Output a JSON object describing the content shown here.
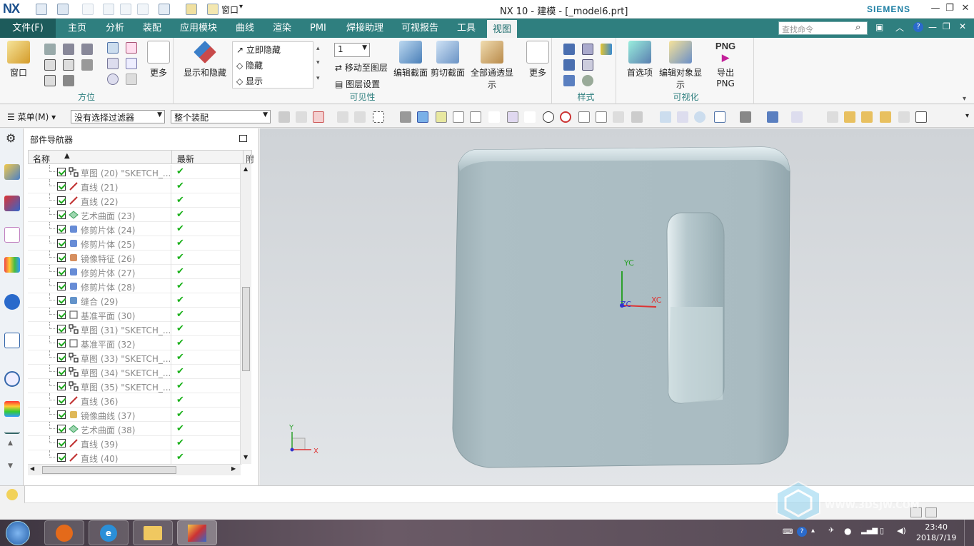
{
  "titlebar": {
    "logo": "NX",
    "window_title": "NX 10 - 建模 - [_model6.prt]",
    "brand": "SIEMENS",
    "quick_window_label": "窗口"
  },
  "menubar": {
    "file_tab": "文件(F)",
    "tabs": [
      "主页",
      "分析",
      "装配",
      "应用模块",
      "曲线",
      "渲染",
      "PMI",
      "焊接助理",
      "可视报告",
      "工具",
      "视图"
    ],
    "active_tab": "视图",
    "search_placeholder": "查找命令"
  },
  "ribbon": {
    "groups": {
      "orient": {
        "label": "方位",
        "window_btn": "窗口",
        "more_btn": "更多"
      },
      "visibility": {
        "label": "可见性",
        "show_hide_btn": "显示和隐藏",
        "instant_hide": "立即隐藏",
        "hide": "隐藏",
        "show": "显示",
        "layer_value": "1",
        "move_to_layer": "移动至图层",
        "layer_settings": "图层设置",
        "edit_section": "编辑截面",
        "clip_section": "剪切截面",
        "all_see_through": "全部通透显示",
        "more_btn": "更多"
      },
      "style": {
        "label": "样式"
      },
      "visualize": {
        "label": "可视化",
        "preferences": "首选项",
        "edit_object_display": "编辑对象显示",
        "export_png": "导出 PNG",
        "png_icon_text": "PNG"
      }
    }
  },
  "toolbar2": {
    "menu_btn": "菜单(M)",
    "filter_value": "没有选择过滤器",
    "scope_value": "整个装配"
  },
  "navigator": {
    "title": "部件导航器",
    "col_name": "名称",
    "col_latest": "最新",
    "col_extra": "附",
    "rows": [
      {
        "name": "草图 (20) \"SKETCH_...",
        "icon": "sketch"
      },
      {
        "name": "直线 (21)",
        "icon": "line"
      },
      {
        "name": "直线 (22)",
        "icon": "line"
      },
      {
        "name": "艺术曲面 (23)",
        "icon": "studio-surface"
      },
      {
        "name": "修剪片体 (24)",
        "icon": "trim-sheet"
      },
      {
        "name": "修剪片体 (25)",
        "icon": "trim-sheet"
      },
      {
        "name": "镜像特征 (26)",
        "icon": "mirror-feature"
      },
      {
        "name": "修剪片体 (27)",
        "icon": "trim-sheet"
      },
      {
        "name": "修剪片体 (28)",
        "icon": "trim-sheet"
      },
      {
        "name": "缝合 (29)",
        "icon": "sew"
      },
      {
        "name": "基准平面 (30)",
        "icon": "datum-plane"
      },
      {
        "name": "草图 (31) \"SKETCH_...",
        "icon": "sketch"
      },
      {
        "name": "基准平面 (32)",
        "icon": "datum-plane"
      },
      {
        "name": "草图 (33) \"SKETCH_...",
        "icon": "sketch"
      },
      {
        "name": "草图 (34) \"SKETCH_...",
        "icon": "sketch"
      },
      {
        "name": "草图 (35) \"SKETCH_...",
        "icon": "sketch"
      },
      {
        "name": "直线 (36)",
        "icon": "line"
      },
      {
        "name": "镜像曲线 (37)",
        "icon": "mirror-curve"
      },
      {
        "name": "艺术曲面 (38)",
        "icon": "studio-surface"
      },
      {
        "name": "直线 (39)",
        "icon": "line"
      },
      {
        "name": "直线 (40)",
        "icon": "line"
      }
    ]
  },
  "viewport": {
    "wcs_labels": {
      "yc": "YC",
      "xc": "XC",
      "zc": "ZC"
    },
    "abs_axes": {
      "y": "Y",
      "x": "X"
    },
    "watermark": "WWW.3DSJW.COM"
  },
  "taskbar": {
    "time": "23:40",
    "date": "2018/7/19"
  },
  "colors": {
    "menubar": "#2f7f7f",
    "model_body": "#a9bcc2",
    "check_green": "#18b018"
  }
}
